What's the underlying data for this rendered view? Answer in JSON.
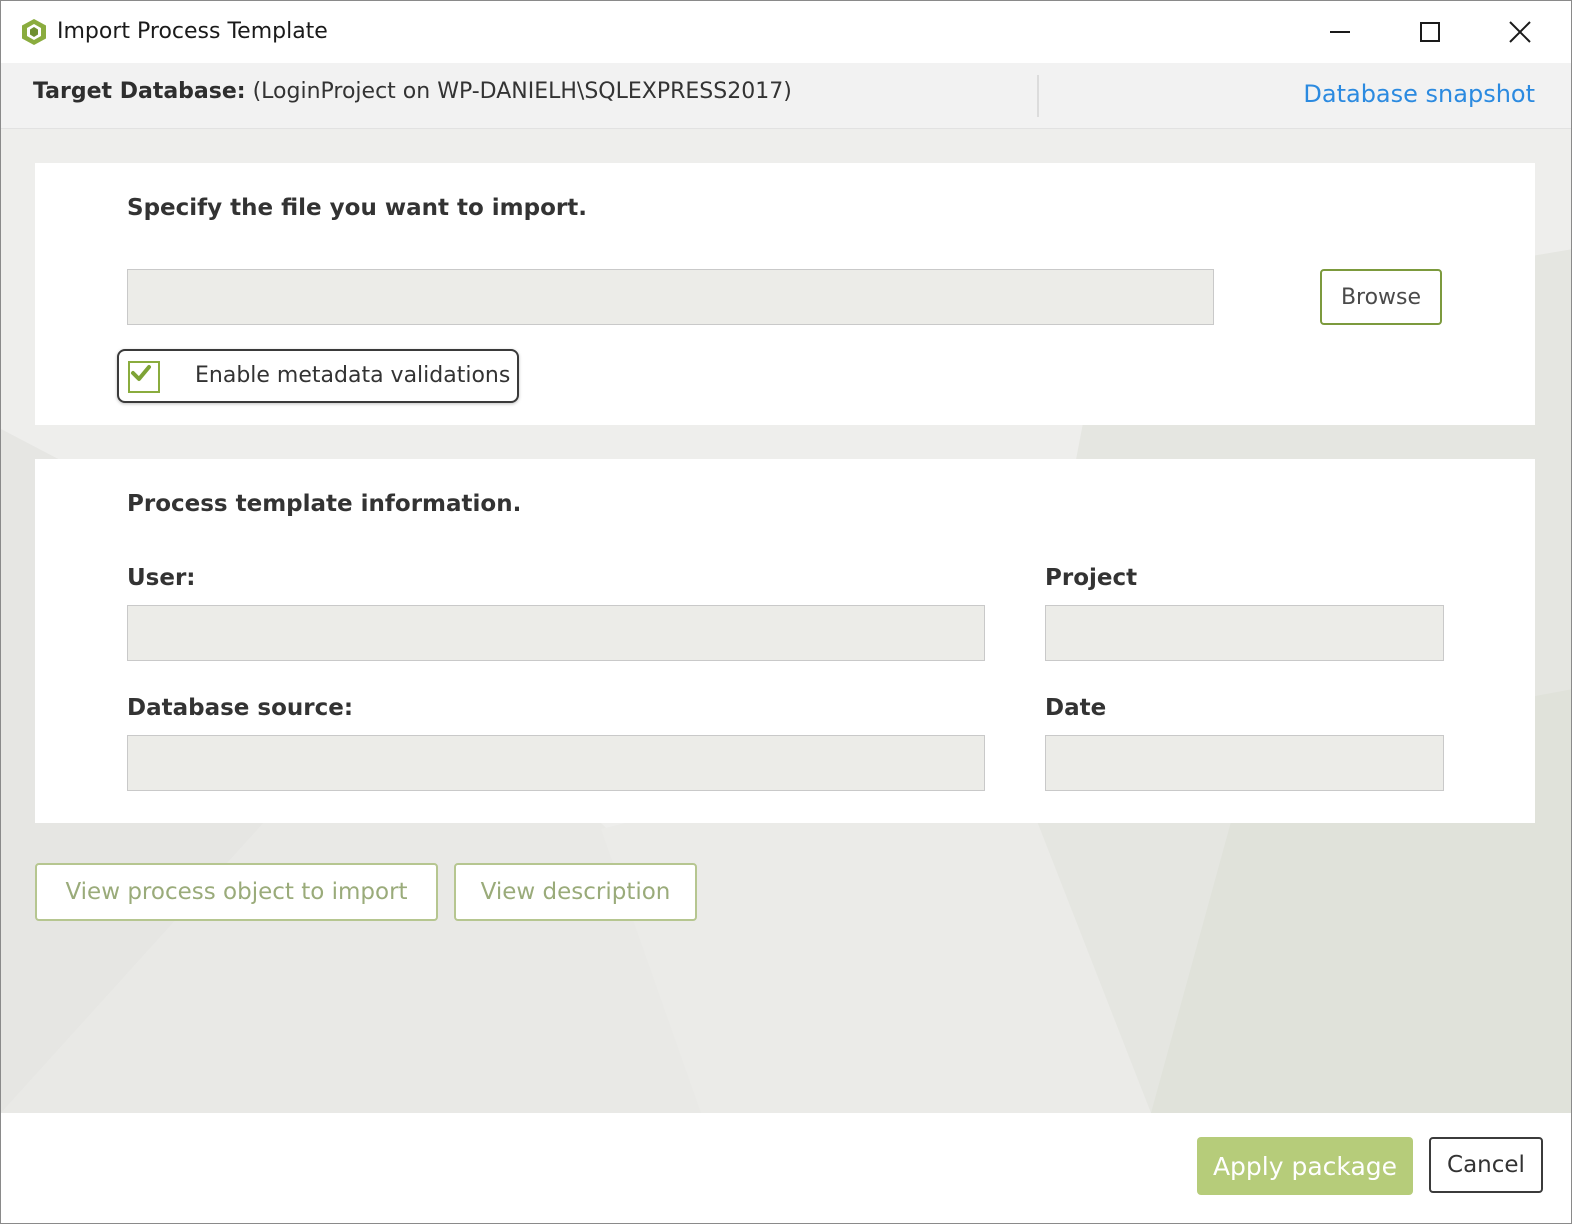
{
  "window": {
    "title": "Import Process Template"
  },
  "header": {
    "target_label": "Target Database:",
    "target_value": "(LoginProject on WP-DANIELH\\SQLEXPRESS2017)",
    "snapshot_link": "Database snapshot"
  },
  "file_section": {
    "title": "Specify the file you want to import.",
    "file_value": "",
    "browse_label": "Browse",
    "validation_checkbox": {
      "label": "Enable metadata validations",
      "checked": true
    }
  },
  "info_section": {
    "title": "Process template information.",
    "user_label": "User:",
    "user_value": "",
    "project_label": "Project",
    "project_value": "",
    "db_source_label": "Database source:",
    "db_source_value": "",
    "date_label": "Date",
    "date_value": ""
  },
  "actions": {
    "view_process_label": "View process object to import",
    "view_description_label": "View description"
  },
  "footer": {
    "apply_label": "Apply package",
    "cancel_label": "Cancel"
  },
  "colors": {
    "accent_green": "#8aac3e",
    "apply_button": "#b6cc7a",
    "link_blue": "#2b8ae0"
  }
}
